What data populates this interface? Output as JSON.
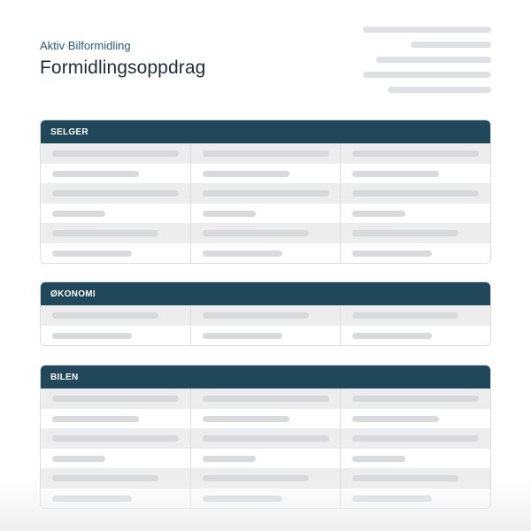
{
  "document": {
    "subtitle": "Aktiv Bilformidling",
    "title": "Formidlingsoppdrag"
  },
  "sections": {
    "selger": {
      "label": "SELGER",
      "rows": 6
    },
    "okonomi": {
      "label": "ØKONOMI",
      "rows": 2
    },
    "bilen": {
      "label": "BILEN",
      "rows": 6
    }
  },
  "colors": {
    "header_bg": "#21475a",
    "title": "#1c2d3c",
    "subtitle": "#2a5a7a",
    "row_shade": "#ededed",
    "placeholder": "#dfe1e6"
  }
}
